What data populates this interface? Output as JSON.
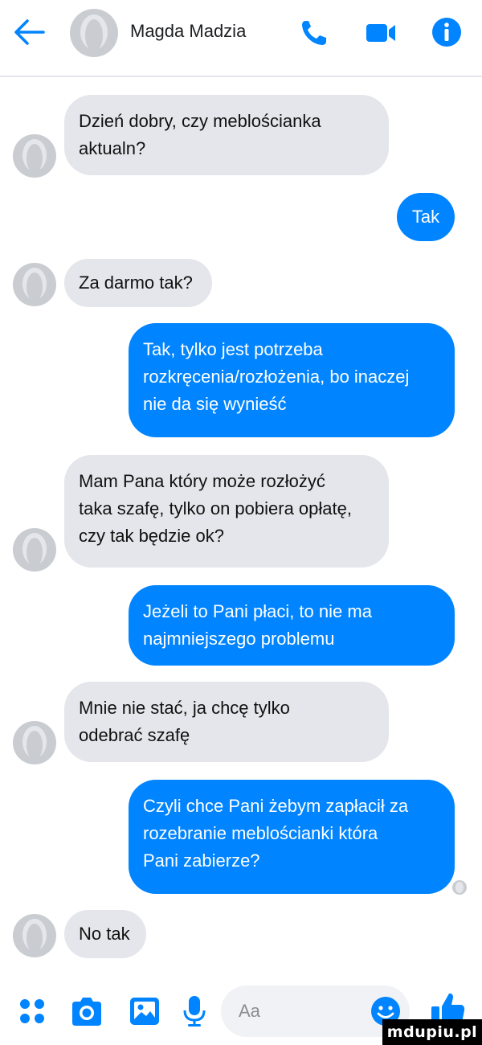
{
  "header": {
    "contact_name": "Magda Madzia",
    "icons": [
      "back-arrow-icon",
      "avatar-placeholder-icon",
      "phone-icon",
      "video-camera-icon",
      "info-icon"
    ],
    "accent_color": "#0084ff"
  },
  "messages": [
    {
      "from": "them",
      "lines": [
        "Dzień dobry, czy meblościanka",
        "aktualn?"
      ]
    },
    {
      "from": "me",
      "lines": [
        "Tak"
      ]
    },
    {
      "from": "them",
      "lines": [
        "Za darmo tak?"
      ]
    },
    {
      "from": "me",
      "lines": [
        "Tak, tylko jest potrzeba",
        "rozkręcenia/rozłożenia, bo inaczej",
        "nie da się wynieść"
      ]
    },
    {
      "from": "them",
      "lines": [
        "Mam Pana który może rozłożyć",
        "taka szafę, tylko on pobiera opłatę,",
        "czy tak będzie ok?"
      ]
    },
    {
      "from": "me",
      "lines": [
        "Jeżeli to Pani płaci, to nie ma",
        "najmniejszego problemu"
      ]
    },
    {
      "from": "them",
      "lines": [
        "Mnie nie stać, ja chcę tylko",
        "odebrać szafę"
      ]
    },
    {
      "from": "me",
      "lines": [
        "Czyli chce Pani żebym zapłacił za",
        "rozebranie meblościanki która",
        "Pani zabierze?"
      ]
    },
    {
      "from": "them",
      "lines": [
        "No tak"
      ]
    }
  ],
  "colors": {
    "incoming_bubble": "#e4e6eb",
    "outgoing_bubble": "#0084ff"
  },
  "composer": {
    "placeholder": "Aa",
    "icons": [
      "apps-grid-icon",
      "camera-icon",
      "gallery-icon",
      "microphone-icon",
      "emoji-icon",
      "thumbs-up-icon"
    ]
  },
  "watermark": "mdupiu.pl"
}
